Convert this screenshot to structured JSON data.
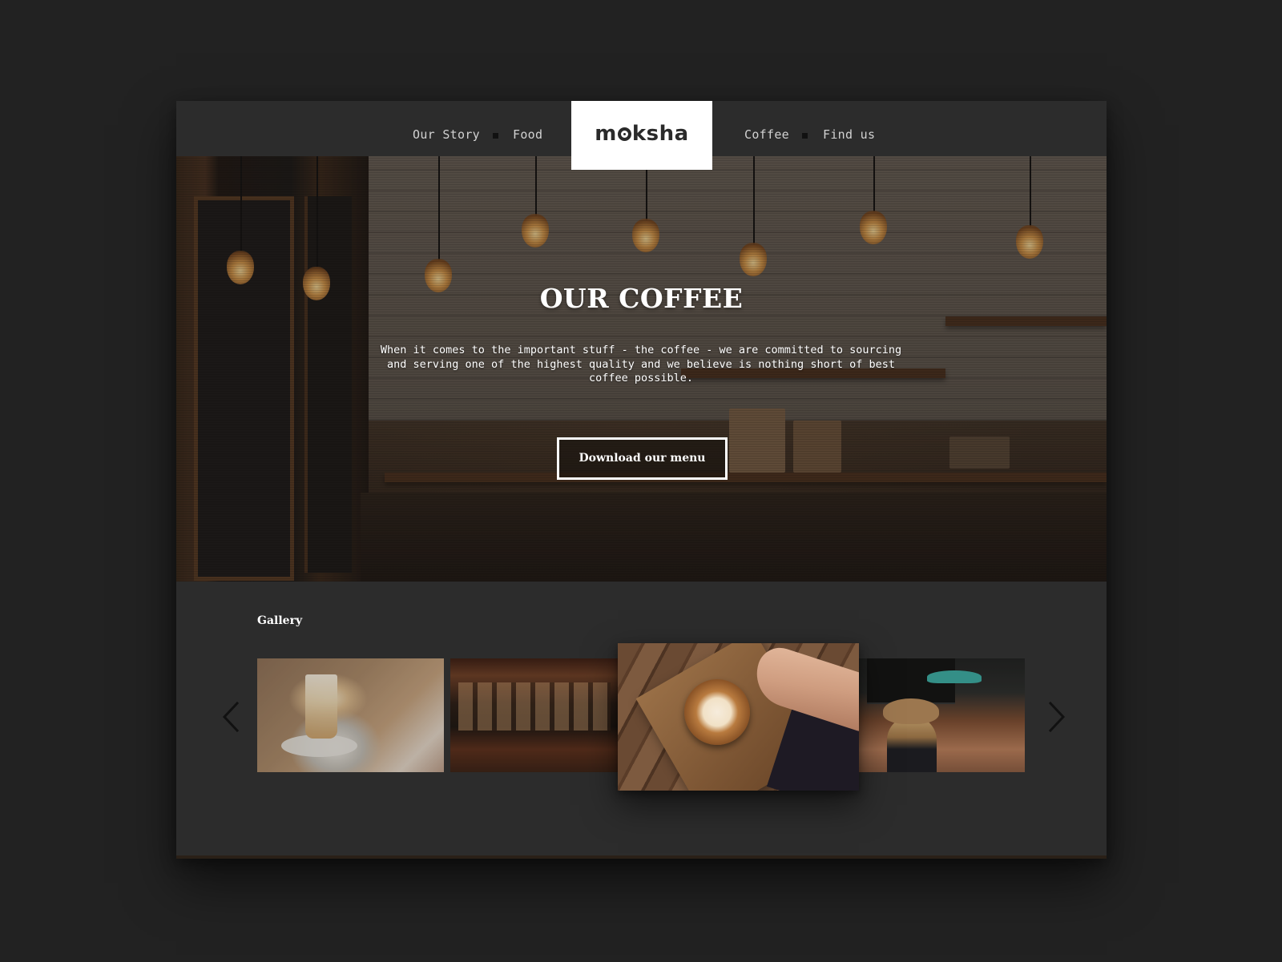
{
  "brand": {
    "logo_text_before": "m",
    "logo_text_after": "ksha",
    "logo_name": "moksha"
  },
  "nav": {
    "left": [
      {
        "label": "Our Story"
      },
      {
        "label": "Food"
      }
    ],
    "right": [
      {
        "label": "Coffee"
      },
      {
        "label": "Find us"
      }
    ]
  },
  "hero": {
    "title": "OUR COFFEE",
    "description": "When it comes to the important stuff - the coffee - we are committed to sourcing and serving one of the highest quality and we believe is nothing short of best coffee possible.",
    "button_label": "Download our menu"
  },
  "gallery": {
    "title": "Gallery",
    "images": [
      {
        "subject": "latte glass on table"
      },
      {
        "subject": "cafe interior"
      },
      {
        "subject": "latte art on wooden board",
        "active": true
      },
      {
        "subject": "customer with hat in cafe"
      }
    ],
    "prev_icon": "chevron-left-icon",
    "next_icon": "chevron-right-icon"
  },
  "colors": {
    "page_background": "#222222",
    "site_background": "#2c2c2c",
    "nav_text": "#d2d2d2",
    "logo_background": "#ffffff",
    "accent_text": "#ffffff"
  }
}
